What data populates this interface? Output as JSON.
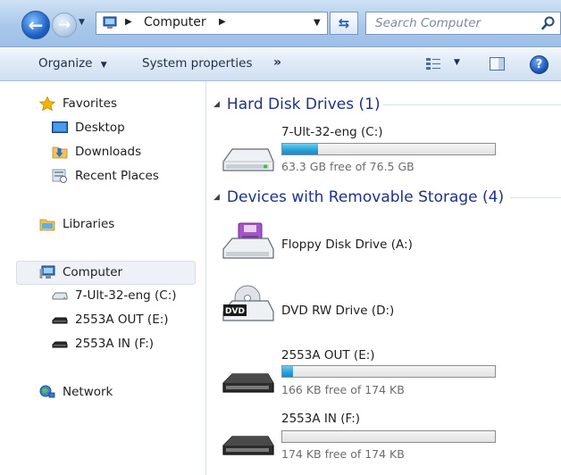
{
  "address_bar": {
    "location": "Computer",
    "search_placeholder": "Search Computer"
  },
  "command_bar": {
    "organize": "Organize",
    "system_properties": "System properties",
    "more": "»"
  },
  "nav": {
    "favorites": "Favorites",
    "desktop": "Desktop",
    "downloads": "Downloads",
    "recent_places": "Recent Places",
    "libraries": "Libraries",
    "computer": "Computer",
    "drive_c": "7-Ult-32-eng (C:)",
    "drive_e": "2553A OUT (E:)",
    "drive_f": "2553A IN (F:)",
    "network": "Network"
  },
  "main": {
    "hard_disk_header": "Hard Disk Drives (1)",
    "removable_header": "Devices with Removable Storage (4)",
    "drives": {
      "c": {
        "name": "7-Ult-32-eng (C:)",
        "free": "63.3 GB free of 76.5 GB",
        "used_fraction": 0.17
      },
      "floppy": {
        "name": "Floppy Disk Drive (A:)",
        "label": ""
      },
      "dvd": {
        "name": "DVD RW Drive (D:)",
        "badge": "DVD"
      },
      "e": {
        "name": "2553A OUT (E:)",
        "free": "166 KB free of 174 KB",
        "used_fraction": 0.05
      },
      "f": {
        "name": "2553A IN (F:)",
        "free": "174 KB free of 174 KB",
        "used_fraction": 0.0
      }
    }
  },
  "colors": {
    "group_header": "#1e3287",
    "bar_fill": "#26a0da"
  }
}
